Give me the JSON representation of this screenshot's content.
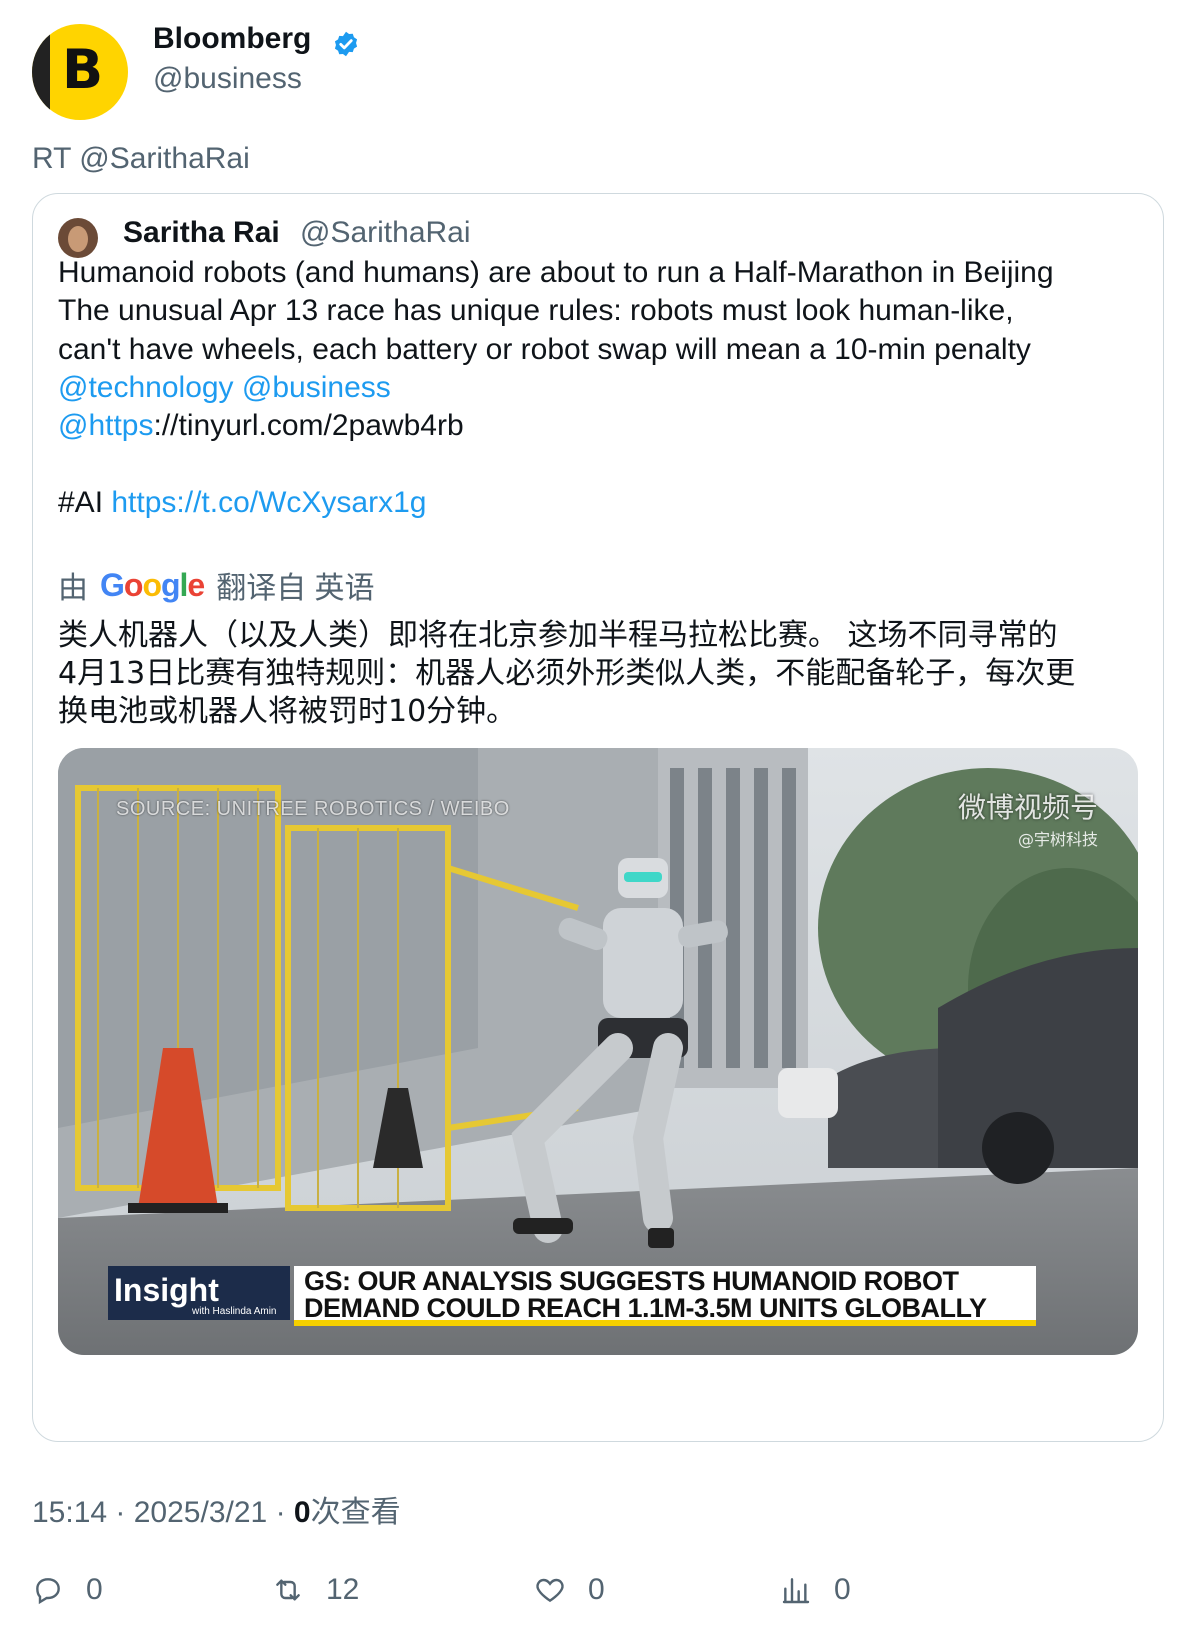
{
  "author": {
    "name": "Bloomberg",
    "handle": "@business",
    "avatar_letter": "B",
    "verified": true
  },
  "retweet_prefix": "RT @SarithaRai",
  "quote": {
    "name": "Saritha Rai",
    "handle": "@SarithaRai",
    "lines": [
      "Humanoid robots (and humans) are about to run a Half-Marathon in Beijing",
      "The unusual Apr 13 race has unique rules: robots must look human-like,",
      "can't have wheels, each battery or robot swap will mean a 10-min penalty"
    ],
    "mentions": [
      "@technology",
      "@business"
    ],
    "url_mention": "@https",
    "url_rest": "://tinyurl.com/2pawb4rb",
    "hashtag": "#AI",
    "tco_link": "https://t.co/WcXysarx1g",
    "translation": {
      "by": "由",
      "google": "Google",
      "from": "翻译自 英语",
      "lines": [
        "类人机器人（以及人类）即将在北京参加半程马拉松比赛。 这场不同寻常的",
        "4月13日比赛有独特规则：机器人必须外形类似人类，不能配备轮子，每次更",
        "换电池或机器人将被罚时10分钟。"
      ]
    },
    "media": {
      "source": "SOURCE: UNITREE ROBOTICS / WEIBO",
      "weibo_watermark": "微博视频号",
      "weibo_sub": "@宇树科技",
      "show_name": "Insight",
      "show_host": "with Haslinda Amin",
      "headline_1": "GS: OUR ANALYSIS SUGGESTS HUMANOID ROBOT",
      "headline_2": "DEMAND COULD REACH 1.1M-3.5M UNITS GLOBALLY"
    }
  },
  "meta": {
    "time": "15:14",
    "date": "2025/3/21",
    "views_count": "0",
    "views_label": "次查看"
  },
  "actions": {
    "replies": "0",
    "retweets": "12",
    "likes": "0",
    "views": "0"
  },
  "colors": {
    "link": "#1d9bf0",
    "muted": "#536471",
    "bloomberg_yellow": "#ffd400"
  }
}
